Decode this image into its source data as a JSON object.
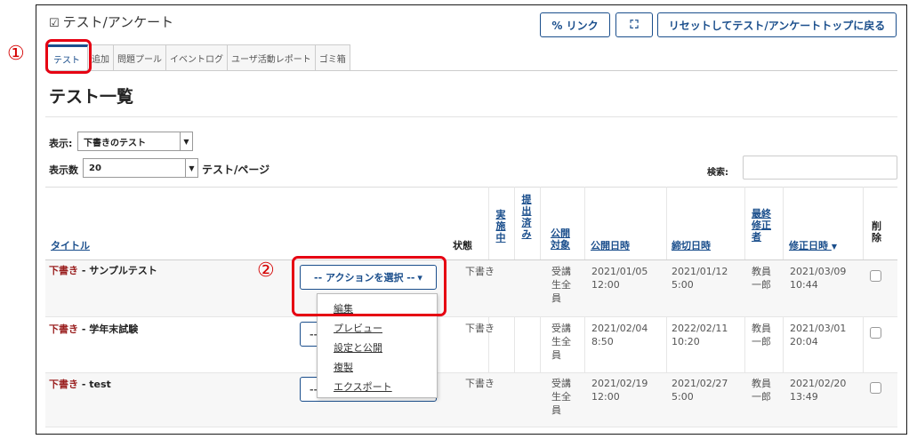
{
  "header": {
    "tool_title": "テスト/アンケート",
    "link_button": "% リンク",
    "expand_icon_glyph": "⛶",
    "reset_button": "リセットしてテスト/アンケートトップに戻る"
  },
  "tabs": [
    {
      "label": "テスト",
      "active": true
    },
    {
      "label": "追加",
      "active": false
    },
    {
      "label": "問題プール",
      "active": false
    },
    {
      "label": "イベントログ",
      "active": false
    },
    {
      "label": "ユーザ活動レポート",
      "active": false
    },
    {
      "label": "ゴミ箱",
      "active": false
    }
  ],
  "page_heading": "テスト一覧",
  "filters": {
    "view_label": "表示:",
    "view_value": "下書きのテスト",
    "count_label": "表示数",
    "count_value": "20",
    "per_page_label": "テスト/ページ",
    "search_label": "検索:"
  },
  "columns": {
    "title": "タイトル",
    "status": "状態",
    "in_progress": "実施中",
    "submitted": "提出済み",
    "audience": "公開対象",
    "open_date": "公開日時",
    "due_date": "締切日時",
    "last_modifier": "最終修正者",
    "modified_date": "修正日時",
    "sort_indicator": "▼",
    "delete": "削除"
  },
  "rows": [
    {
      "prefix": "下書き",
      "separator": " - ",
      "name": "サンプルテスト",
      "status": "下書き",
      "audience": "受講生全員",
      "open_date": "2021/01/05",
      "open_time": "12:00",
      "due_date": "2021/01/12",
      "due_time": "5:00",
      "modifier": "教員一郎",
      "mod_date": "2021/03/09",
      "mod_time": "10:44"
    },
    {
      "prefix": "下書き",
      "separator": " - ",
      "name": "学年末試験",
      "status": "下書き",
      "audience": "受講生全員",
      "open_date": "2021/02/04",
      "open_time": "8:50",
      "due_date": "2022/02/11",
      "due_time": "10:20",
      "modifier": "教員一郎",
      "mod_date": "2021/03/01",
      "mod_time": "20:04"
    },
    {
      "prefix": "下書き",
      "separator": " - ",
      "name": "test",
      "status": "下書き",
      "audience": "受講生全員",
      "open_date": "2021/02/19",
      "open_time": "12:00",
      "due_date": "2021/02/27",
      "due_time": "5:00",
      "modifier": "教員一郎",
      "mod_date": "2021/02/20",
      "mod_time": "13:49"
    }
  ],
  "action_select": {
    "label": "-- アクションを選択 --",
    "arrow": "▾",
    "partial_label": "--"
  },
  "action_menu": [
    {
      "label": "編集"
    },
    {
      "label": "プレビュー"
    },
    {
      "label": "設定と公開"
    },
    {
      "label": "複製"
    },
    {
      "label": "エクスポート"
    }
  ],
  "annotations": {
    "marker_1": "①",
    "marker_2": "②",
    "color": "#e60012"
  },
  "colors": {
    "accent": "#1a4e8c",
    "draft": "#9a1f1f"
  }
}
